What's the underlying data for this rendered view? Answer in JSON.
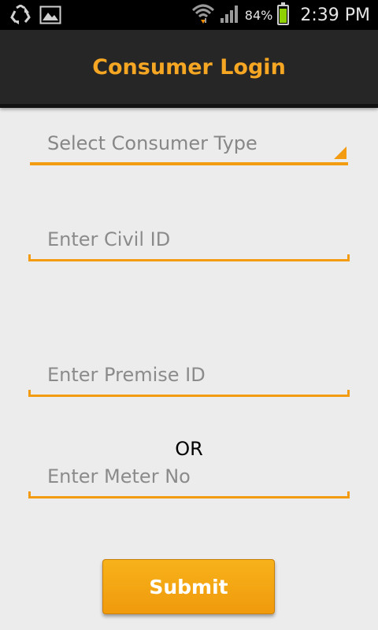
{
  "status_bar": {
    "battery_percent": "84%",
    "time": "2:39 PM",
    "icons": [
      "recycle-icon",
      "image-icon",
      "wifi-icon",
      "signal-icon",
      "battery-icon"
    ]
  },
  "header": {
    "title": "Consumer Login"
  },
  "form": {
    "consumer_type": {
      "placeholder": "Select Consumer Type"
    },
    "civil_id": {
      "placeholder": "Enter Civil ID"
    },
    "premise_id": {
      "placeholder": "Enter Premise ID"
    },
    "or_label": "OR",
    "meter_no": {
      "placeholder": "Enter Meter No"
    },
    "submit_label": "Submit"
  },
  "colors": {
    "accent": "#f39c12",
    "titlebar_bg": "#262626",
    "page_bg": "#ececec"
  }
}
